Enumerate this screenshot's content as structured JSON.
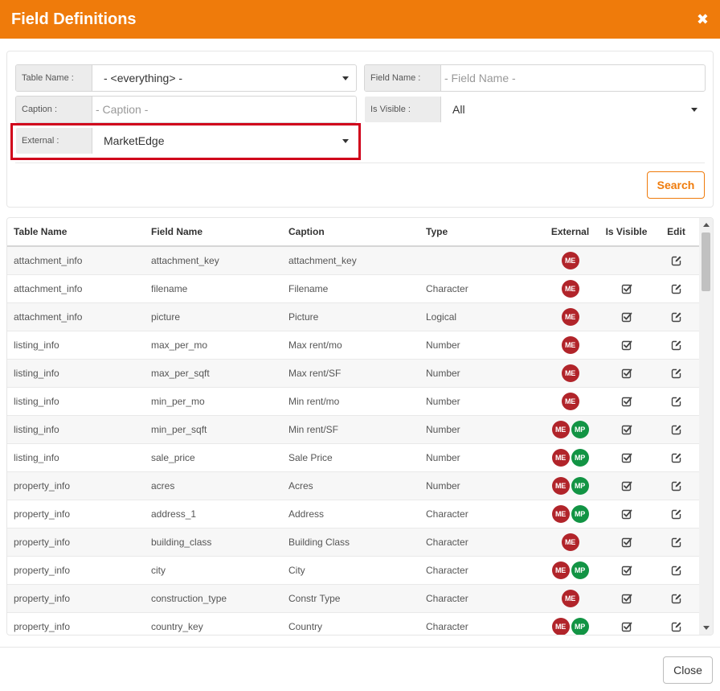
{
  "dialog": {
    "title": "Field Definitions",
    "close_glyph": "✖"
  },
  "filters": {
    "table_name": {
      "label": "Table Name :",
      "value": "- <everything> -"
    },
    "field_name": {
      "label": "Field Name :",
      "placeholder": "- Field Name -"
    },
    "caption": {
      "label": "Caption :",
      "placeholder": "- Caption -"
    },
    "is_visible": {
      "label": "Is Visible :",
      "value": "All"
    },
    "external": {
      "label": "External :",
      "value": "MarketEdge"
    },
    "search_label": "Search",
    "highlight_color": "#d0021b"
  },
  "table": {
    "headers": [
      "Table Name",
      "Field Name",
      "Caption",
      "Type",
      "External",
      "Is Visible",
      "Edit"
    ],
    "rows": [
      {
        "table": "attachment_info",
        "field": "attachment_key",
        "caption": "attachment_key",
        "type": "",
        "external": [
          "ME"
        ],
        "visible": false
      },
      {
        "table": "attachment_info",
        "field": "filename",
        "caption": "Filename",
        "type": "Character",
        "external": [
          "ME"
        ],
        "visible": true
      },
      {
        "table": "attachment_info",
        "field": "picture",
        "caption": "Picture",
        "type": "Logical",
        "external": [
          "ME"
        ],
        "visible": true
      },
      {
        "table": "listing_info",
        "field": "max_per_mo",
        "caption": "Max rent/mo",
        "type": "Number",
        "external": [
          "ME"
        ],
        "visible": true
      },
      {
        "table": "listing_info",
        "field": "max_per_sqft",
        "caption": "Max rent/SF",
        "type": "Number",
        "external": [
          "ME"
        ],
        "visible": true
      },
      {
        "table": "listing_info",
        "field": "min_per_mo",
        "caption": "Min rent/mo",
        "type": "Number",
        "external": [
          "ME"
        ],
        "visible": true
      },
      {
        "table": "listing_info",
        "field": "min_per_sqft",
        "caption": "Min rent/SF",
        "type": "Number",
        "external": [
          "ME",
          "MP"
        ],
        "visible": true
      },
      {
        "table": "listing_info",
        "field": "sale_price",
        "caption": "Sale Price",
        "type": "Number",
        "external": [
          "ME",
          "MP"
        ],
        "visible": true
      },
      {
        "table": "property_info",
        "field": "acres",
        "caption": "Acres",
        "type": "Number",
        "external": [
          "ME",
          "MP"
        ],
        "visible": true
      },
      {
        "table": "property_info",
        "field": "address_1",
        "caption": "Address",
        "type": "Character",
        "external": [
          "ME",
          "MP"
        ],
        "visible": true
      },
      {
        "table": "property_info",
        "field": "building_class",
        "caption": "Building Class",
        "type": "Character",
        "external": [
          "ME"
        ],
        "visible": true
      },
      {
        "table": "property_info",
        "field": "city",
        "caption": "City",
        "type": "Character",
        "external": [
          "ME",
          "MP"
        ],
        "visible": true
      },
      {
        "table": "property_info",
        "field": "construction_type",
        "caption": "Constr Type",
        "type": "Character",
        "external": [
          "ME"
        ],
        "visible": true
      },
      {
        "table": "property_info",
        "field": "country_key",
        "caption": "Country",
        "type": "Character",
        "external": [
          "ME",
          "MP"
        ],
        "visible": true
      }
    ]
  },
  "colors": {
    "accent": "#ef7b0b",
    "badge_me": "#b1242a",
    "badge_mp": "#129444"
  },
  "icons": {
    "visible": "checkbox-checked-icon",
    "edit": "edit-icon"
  },
  "footer": {
    "close_label": "Close"
  }
}
